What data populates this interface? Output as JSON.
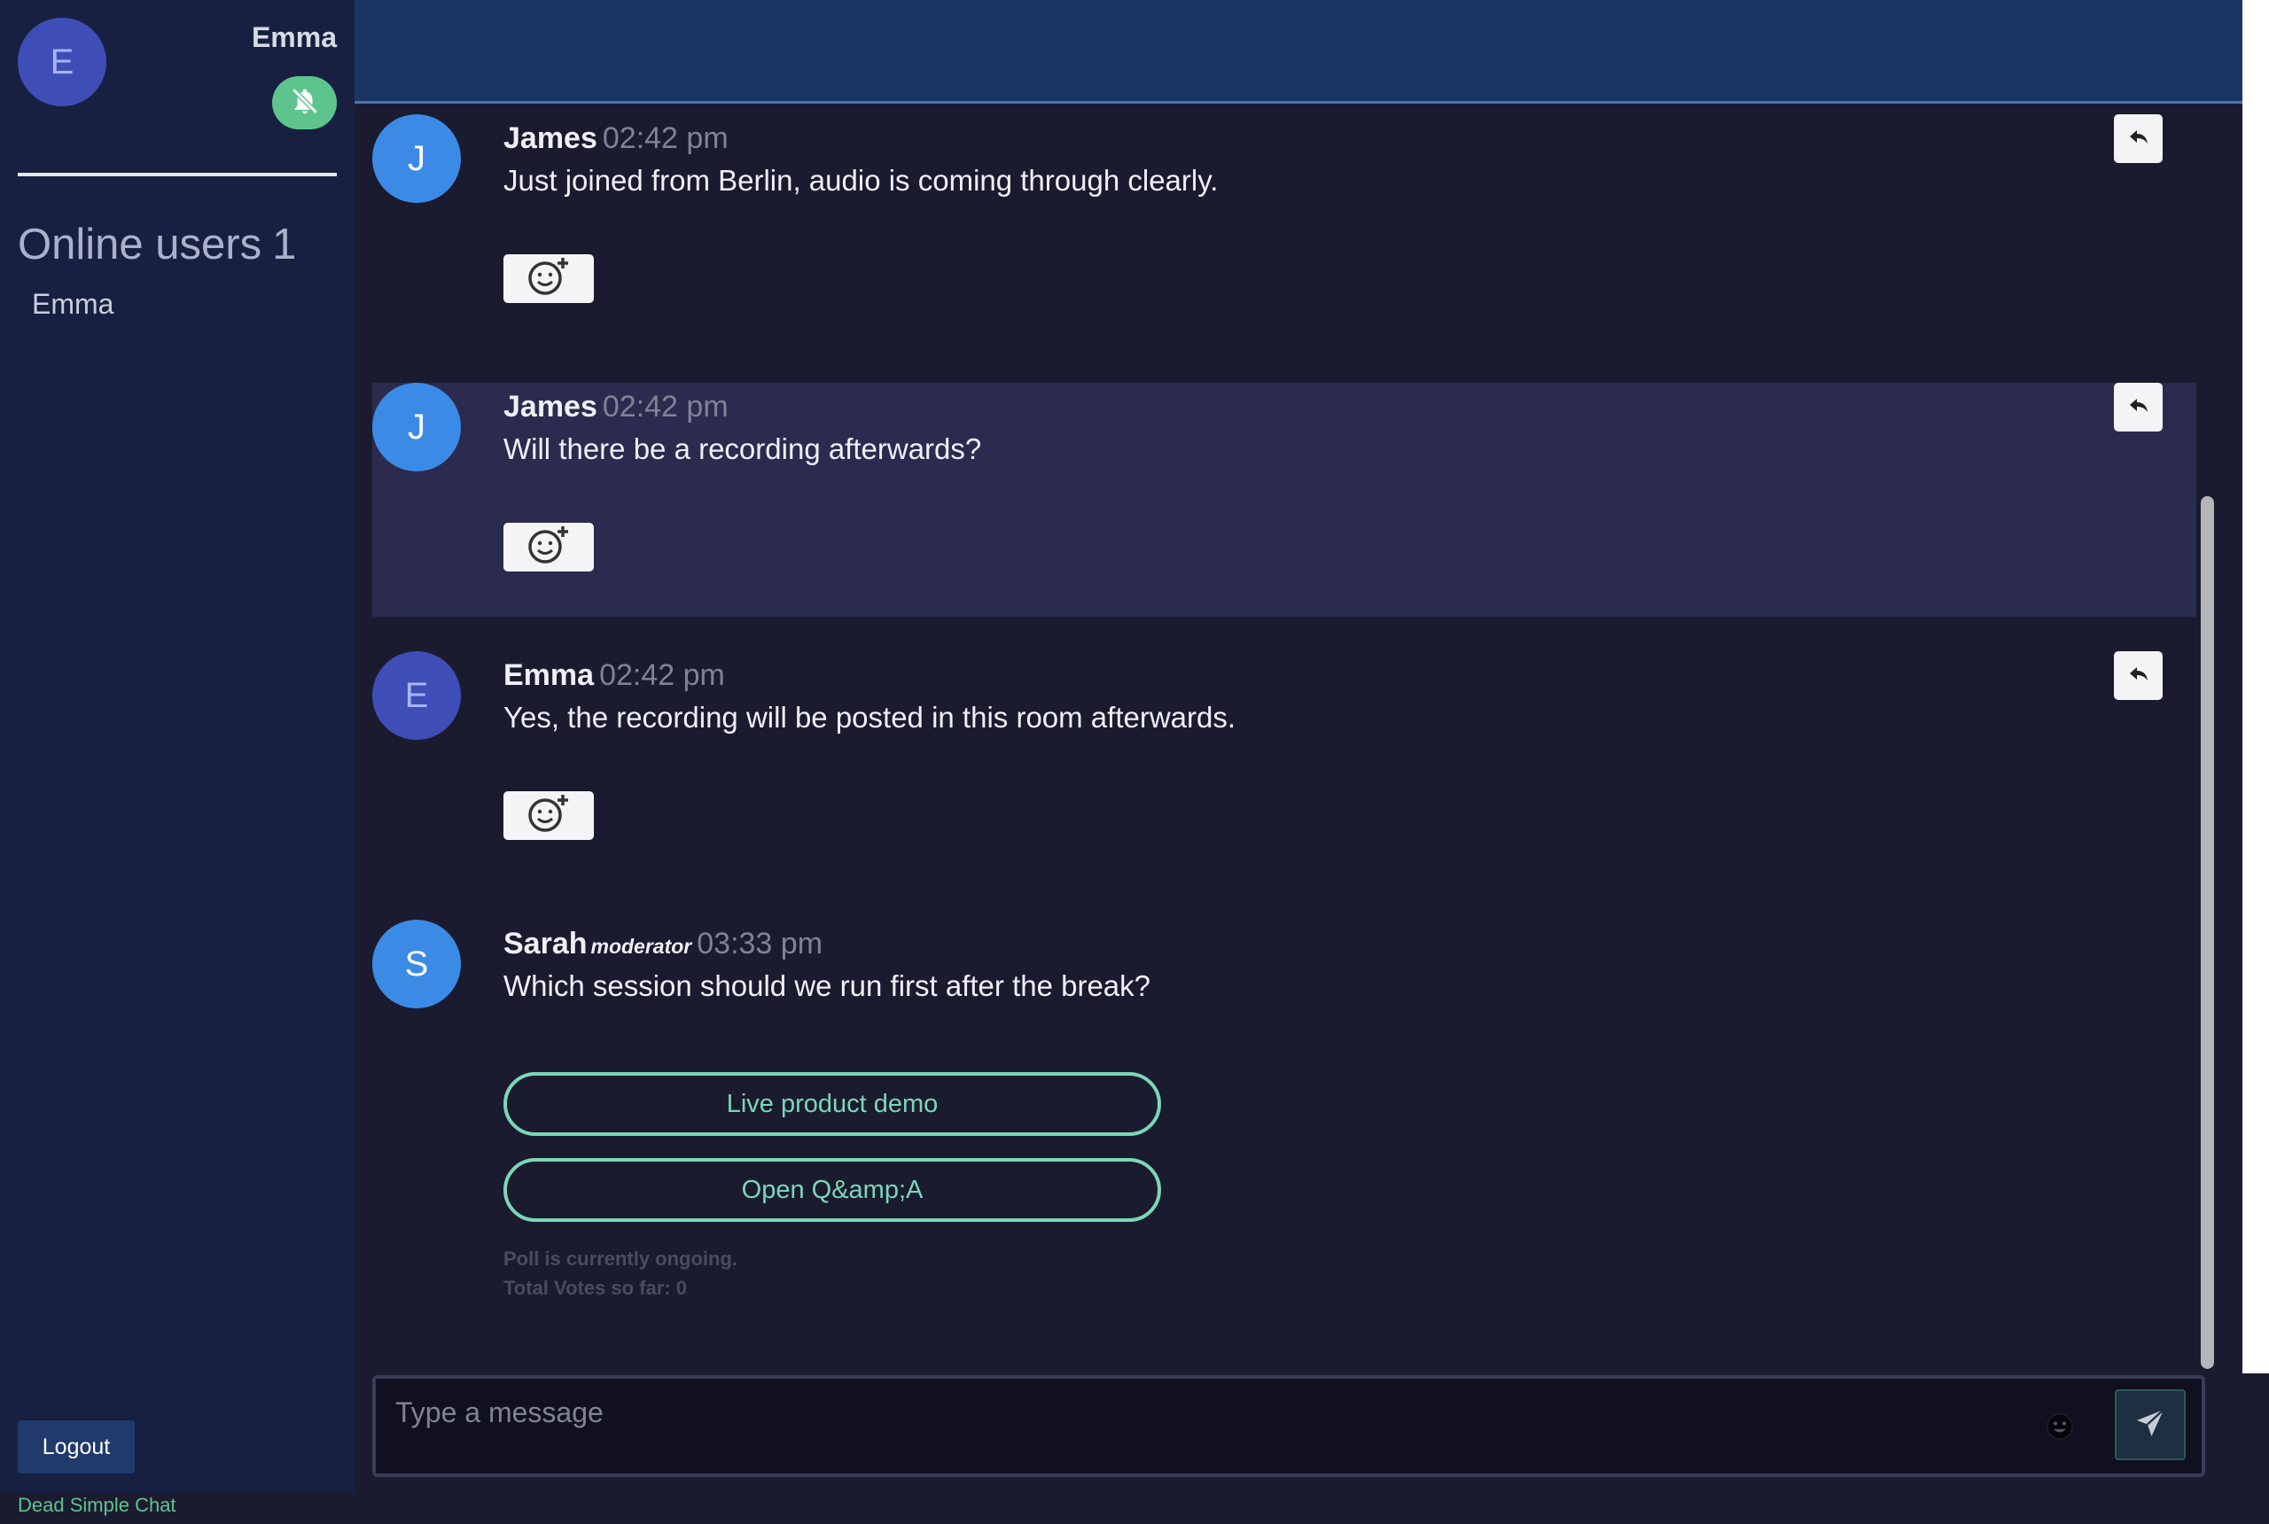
{
  "sidebar": {
    "me": {
      "initial": "E",
      "name": "Emma"
    },
    "online_title": "Online users",
    "online_count": "1",
    "online_users": [
      "Emma"
    ],
    "logout_label": "Logout",
    "brand": "Dead Simple Chat"
  },
  "messages": [
    {
      "initial": "J",
      "author": "James",
      "time": "02:42 pm",
      "text": "Just joined from Berlin, audio is coming through clearly."
    },
    {
      "initial": "J",
      "author": "James",
      "time": "02:42 pm",
      "text": "Will there be a recording afterwards?"
    },
    {
      "initial": "E",
      "author": "Emma",
      "time": "02:42 pm",
      "text": "Yes, the recording will be posted in this room afterwards."
    },
    {
      "initial": "S",
      "author": "Sarah",
      "role": "moderator",
      "time": "03:33 pm",
      "text": "Which session should we run first after the break?"
    }
  ],
  "poll": {
    "options": [
      "Live product demo",
      "Open Q&amp;A"
    ],
    "status": "Poll is currently ongoing.",
    "votes": "Total Votes so far: 0"
  },
  "composer": {
    "placeholder": "Type a message"
  },
  "colors": {
    "sidebar": "#172041",
    "header": "#1b3563",
    "accent_green": "#5ec48e",
    "poll_outline": "#7bd7b7",
    "avatar_blue": "#3b8be6",
    "avatar_indigo": "#3f4eb6"
  },
  "icons": {
    "mute": "bell-slash-icon",
    "reaction": "add-reaction-icon",
    "reply": "reply-icon",
    "emoji": "emoji-icon",
    "send": "send-icon"
  }
}
